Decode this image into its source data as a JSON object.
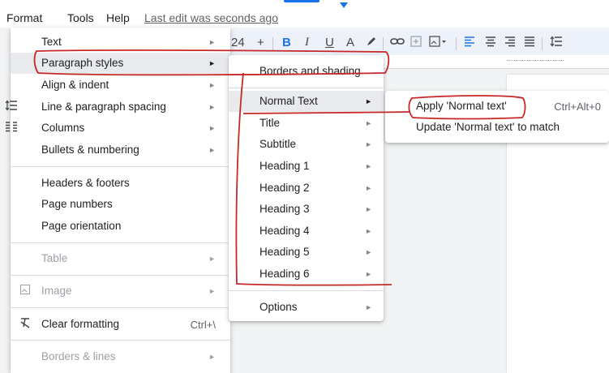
{
  "menubar": {
    "items": [
      "Format",
      "Tools",
      "Help"
    ],
    "last_edit": "Last edit was seconds ago"
  },
  "toolbar": {
    "font_size": "24",
    "plus": "+",
    "bold": "B",
    "italic": "I",
    "underline": "U",
    "text_color": "A"
  },
  "format_menu": {
    "items": [
      {
        "label": "Text"
      },
      {
        "label": "Paragraph styles"
      },
      {
        "label": "Align & indent"
      },
      {
        "label": "Line & paragraph spacing"
      },
      {
        "label": "Columns"
      },
      {
        "label": "Bullets & numbering"
      },
      {
        "label": "Headers & footers"
      },
      {
        "label": "Page numbers"
      },
      {
        "label": "Page orientation"
      },
      {
        "label": "Table"
      },
      {
        "label": "Image"
      },
      {
        "label": "Clear formatting",
        "shortcut": "Ctrl+\\"
      },
      {
        "label": "Borders & lines"
      }
    ]
  },
  "paragraph_styles_menu": {
    "items": [
      {
        "label": "Borders and shading"
      },
      {
        "label": "Normal Text"
      },
      {
        "label": "Title"
      },
      {
        "label": "Subtitle"
      },
      {
        "label": "Heading 1"
      },
      {
        "label": "Heading 2"
      },
      {
        "label": "Heading 3"
      },
      {
        "label": "Heading 4"
      },
      {
        "label": "Heading 5"
      },
      {
        "label": "Heading 6"
      },
      {
        "label": "Options"
      }
    ]
  },
  "normal_text_menu": {
    "items": [
      {
        "label": "Apply 'Normal text'",
        "shortcut": "Ctrl+Alt+0"
      },
      {
        "label": "Update 'Normal text' to match"
      }
    ]
  },
  "colors": {
    "accent": "#1a73e8",
    "annotation": "#c62828"
  }
}
